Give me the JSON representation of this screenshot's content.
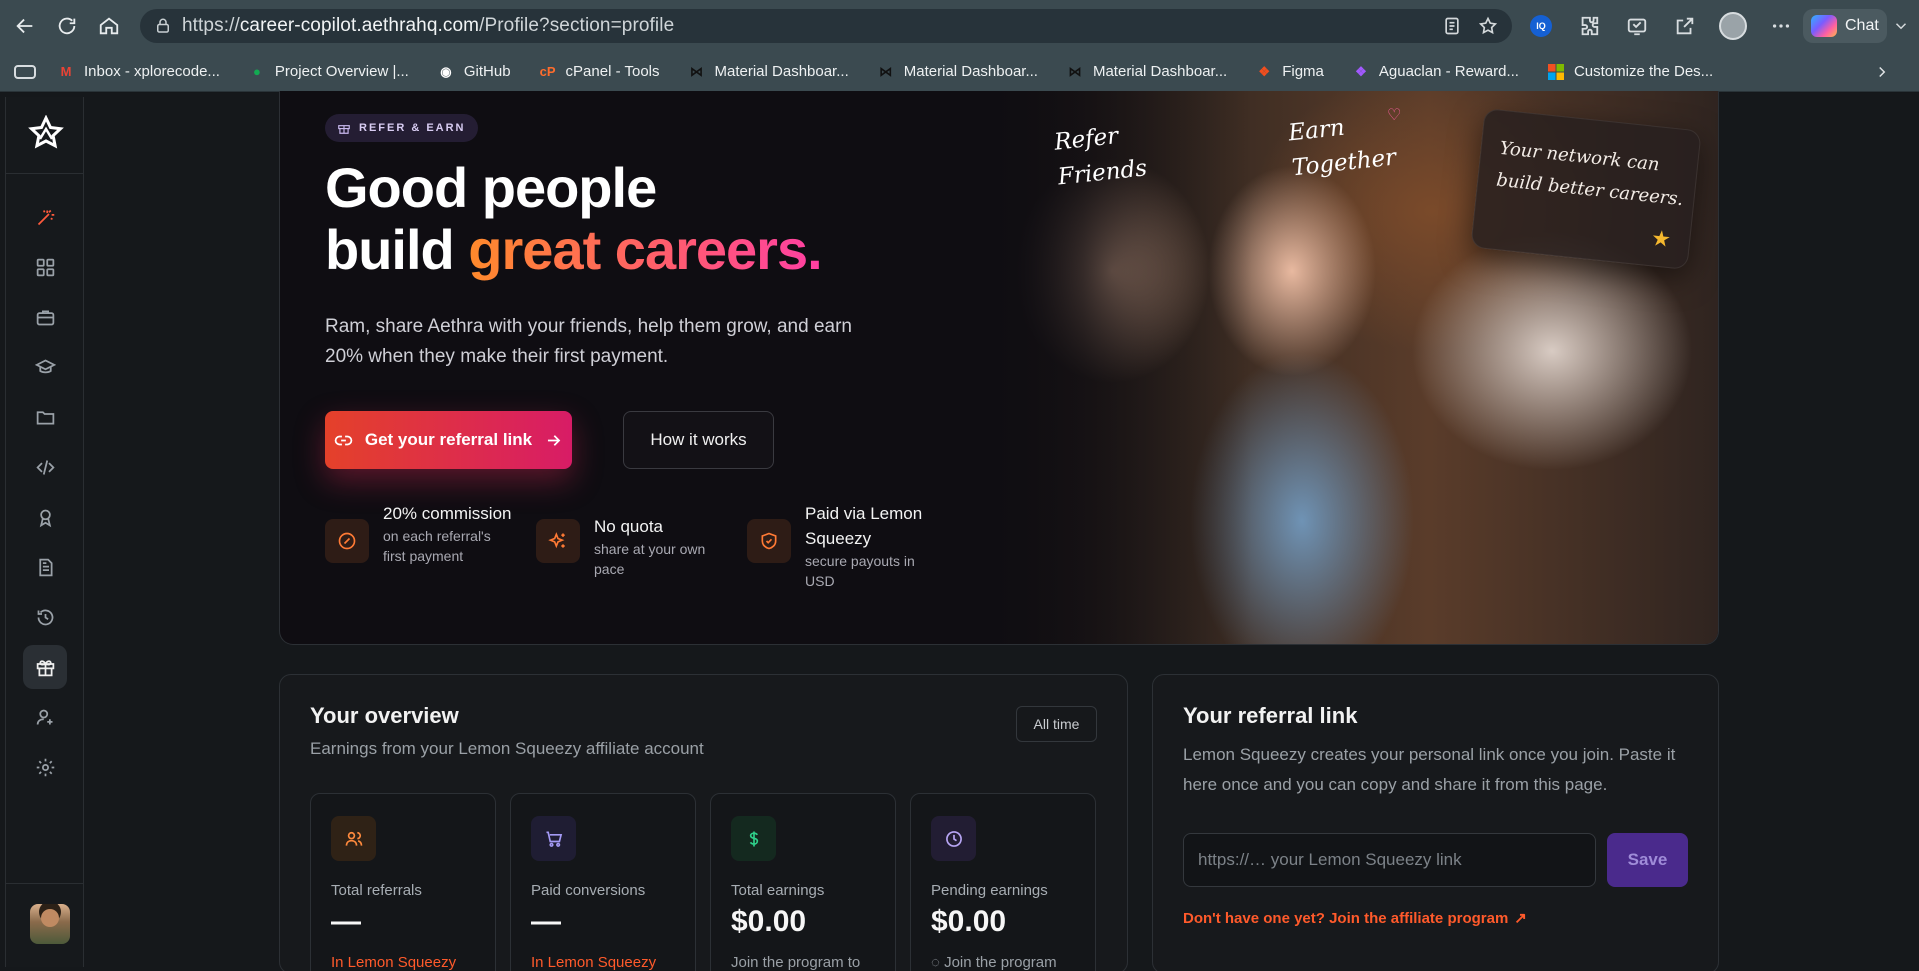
{
  "browser": {
    "url_prefix": "https://",
    "url_domain": "career-copilot.aethrahq.com",
    "url_path": "/Profile?section=profile",
    "chat_label": "Chat"
  },
  "bookmarks": [
    {
      "label": "Inbox - xplorecode...",
      "icon": "gmail-icon"
    },
    {
      "label": "Project Overview |...",
      "icon": "mongodb-icon"
    },
    {
      "label": "GitHub",
      "icon": "github-icon"
    },
    {
      "label": "cPanel - Tools",
      "icon": "cpanel-icon"
    },
    {
      "label": "Material Dashboar...",
      "icon": "material-icon"
    },
    {
      "label": "Material Dashboar...",
      "icon": "material-icon"
    },
    {
      "label": "Material Dashboar...",
      "icon": "material-icon"
    },
    {
      "label": "Figma",
      "icon": "figma-icon"
    },
    {
      "label": "Aguaclan - Reward...",
      "icon": "figma-icon"
    },
    {
      "label": "Customize the Des...",
      "icon": "microsoft-icon"
    }
  ],
  "hero": {
    "badge": "REFER & EARN",
    "title_line1": "Good people",
    "title_line2_plain": "build ",
    "title_line2_accent": "great careers.",
    "subtitle": "Ram, share Aethra with your friends, help them grow, and earn 20% when they make their first payment.",
    "primary_button": "Get your referral link",
    "secondary_button": "How it works",
    "features": [
      {
        "title": "20% commission",
        "desc": "on each referral's first payment"
      },
      {
        "title": "No quota",
        "desc": "share at your own pace"
      },
      {
        "title": "Paid via Lemon Squeezy",
        "desc": "secure payouts in USD"
      }
    ],
    "photo_text": {
      "refer_1": "Refer",
      "refer_2": "Friends",
      "earn_1": "Earn",
      "earn_2": "Together",
      "note": "Your network can build better careers."
    }
  },
  "overview": {
    "title": "Your overview",
    "subtitle": "Earnings from your Lemon Squeezy affiliate account",
    "filter": "All time",
    "stats": [
      {
        "label": "Total referrals",
        "value": "—",
        "note": "In Lemon Squeezy",
        "accent": "#ff8a3d"
      },
      {
        "label": "Paid conversions",
        "value": "—",
        "note": "In Lemon Squeezy",
        "accent": "#8b7cf6"
      },
      {
        "label": "Total earnings",
        "value": "$0.00",
        "note": "Join the program to",
        "accent": "#2fd08a"
      },
      {
        "label": "Pending earnings",
        "value": "$0.00",
        "note": "◌ Join the program",
        "accent": "#a78bfa"
      }
    ]
  },
  "referral": {
    "title": "Your referral link",
    "subtitle": "Lemon Squeezy creates your personal link once you join. Paste it here once and you can copy and share it from this page.",
    "placeholder": "https://… your Lemon Squeezy link",
    "save": "Save",
    "join_link": "Don't have one yet? Join the affiliate program"
  },
  "colors": {
    "accent_orange": "#ff5a2b",
    "accent_purple": "#4a2a8c",
    "primary_gradient_start": "#e4412a",
    "primary_gradient_end": "#d81c66"
  }
}
